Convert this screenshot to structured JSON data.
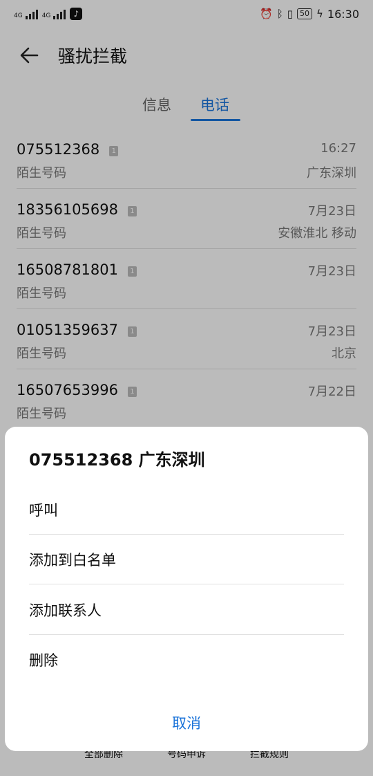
{
  "status_bar": {
    "signal1": "4G",
    "signal2": "4G",
    "battery": "50",
    "time": "16:30"
  },
  "app_bar": {
    "title": "骚扰拦截"
  },
  "tabs": [
    {
      "label": "信息",
      "active": false
    },
    {
      "label": "电话",
      "active": true
    }
  ],
  "calls": [
    {
      "number": "075512368",
      "type": "陌生号码",
      "time": "16:27",
      "location": "广东深圳"
    },
    {
      "number": "18356105698",
      "type": "陌生号码",
      "time": "7月23日",
      "location": "安徽淮北 移动"
    },
    {
      "number": "16508781801",
      "type": "陌生号码",
      "time": "7月23日",
      "location": ""
    },
    {
      "number": "01051359637",
      "type": "陌生号码",
      "time": "7月23日",
      "location": "北京"
    },
    {
      "number": "16507653996",
      "type": "陌生号码",
      "time": "7月22日",
      "location": ""
    }
  ],
  "bottom_bar": {
    "delete_all": "全部删除",
    "appeal": "号码申诉",
    "rules": "拦截规则"
  },
  "sheet": {
    "title": "075512368 广东深圳",
    "options": [
      "呼叫",
      "添加到白名单",
      "添加联系人",
      "删除"
    ],
    "cancel": "取消"
  },
  "colors": {
    "accent": "#1a73d9"
  }
}
